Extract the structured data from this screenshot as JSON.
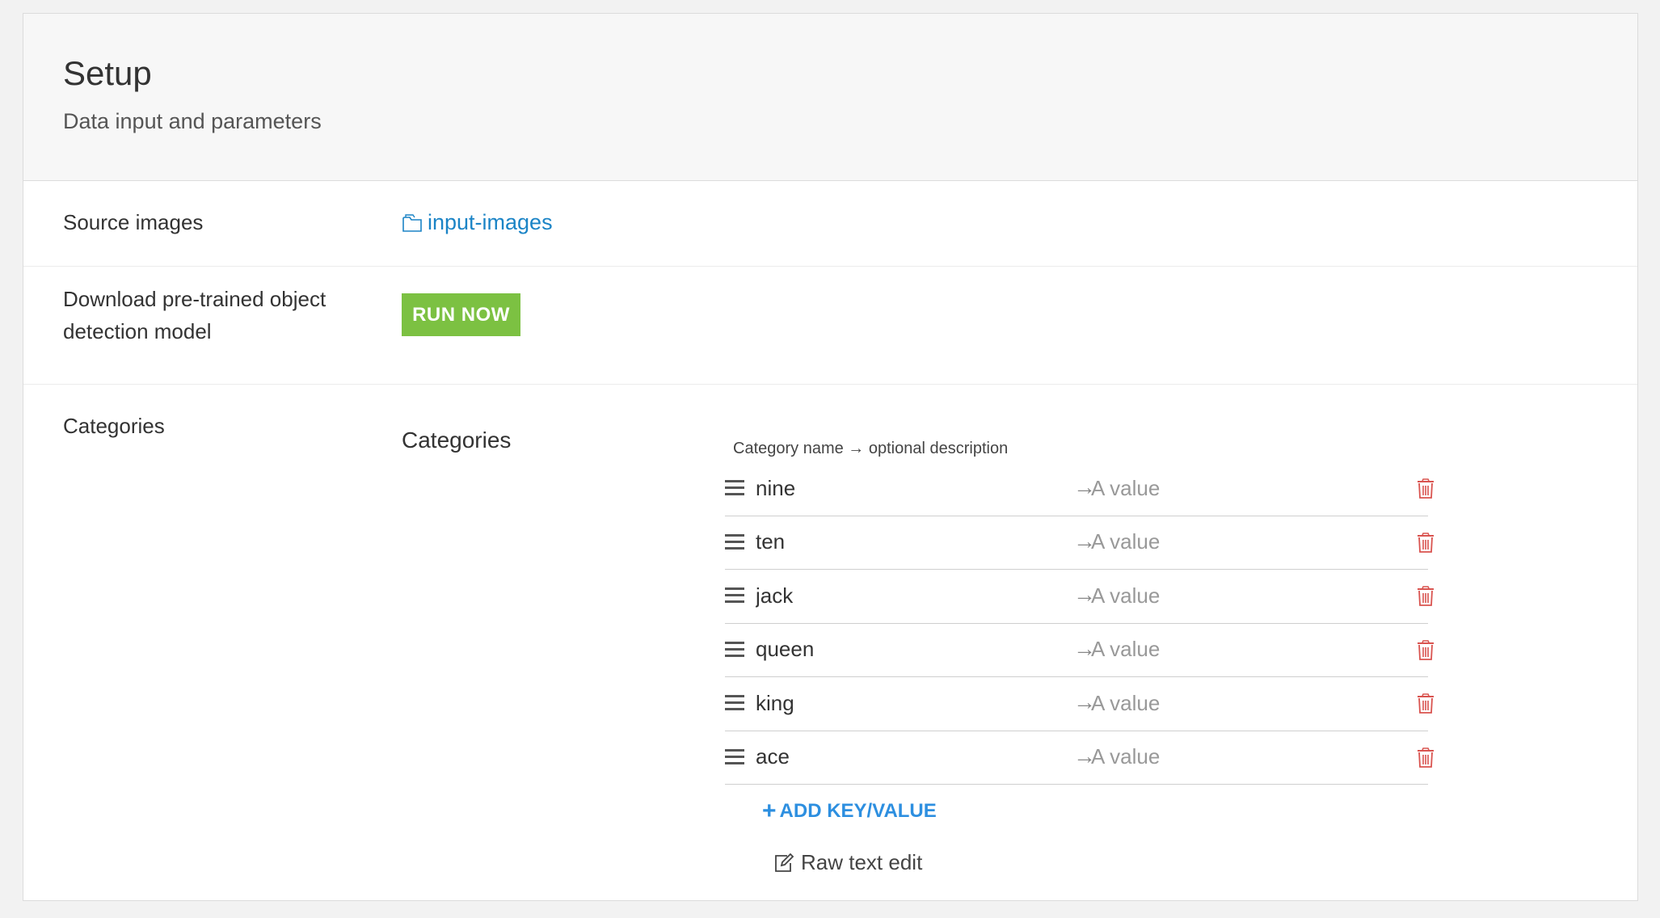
{
  "header": {
    "title": "Setup",
    "subtitle": "Data input and parameters"
  },
  "source_images": {
    "label": "Source images",
    "link_text": "input-images",
    "icon": "folder-icon"
  },
  "download": {
    "label": "Download pre-trained object detection model",
    "button_label": "RUN NOW"
  },
  "categories": {
    "label": "Categories",
    "subheading": "Categories",
    "caption": "Category name → optional description",
    "arrow": "→",
    "value_placeholder": "A value",
    "items": [
      {
        "key": "nine",
        "value": ""
      },
      {
        "key": "ten",
        "value": ""
      },
      {
        "key": "jack",
        "value": ""
      },
      {
        "key": "queen",
        "value": ""
      },
      {
        "key": "king",
        "value": ""
      },
      {
        "key": "ace",
        "value": ""
      }
    ],
    "add_label": "ADD KEY/VALUE",
    "raw_edit_label": "Raw text edit"
  },
  "colors": {
    "run_button": "#7cc142",
    "link": "#1b84c6",
    "add_link": "#2d8fe0",
    "delete_icon": "#d9534f"
  }
}
